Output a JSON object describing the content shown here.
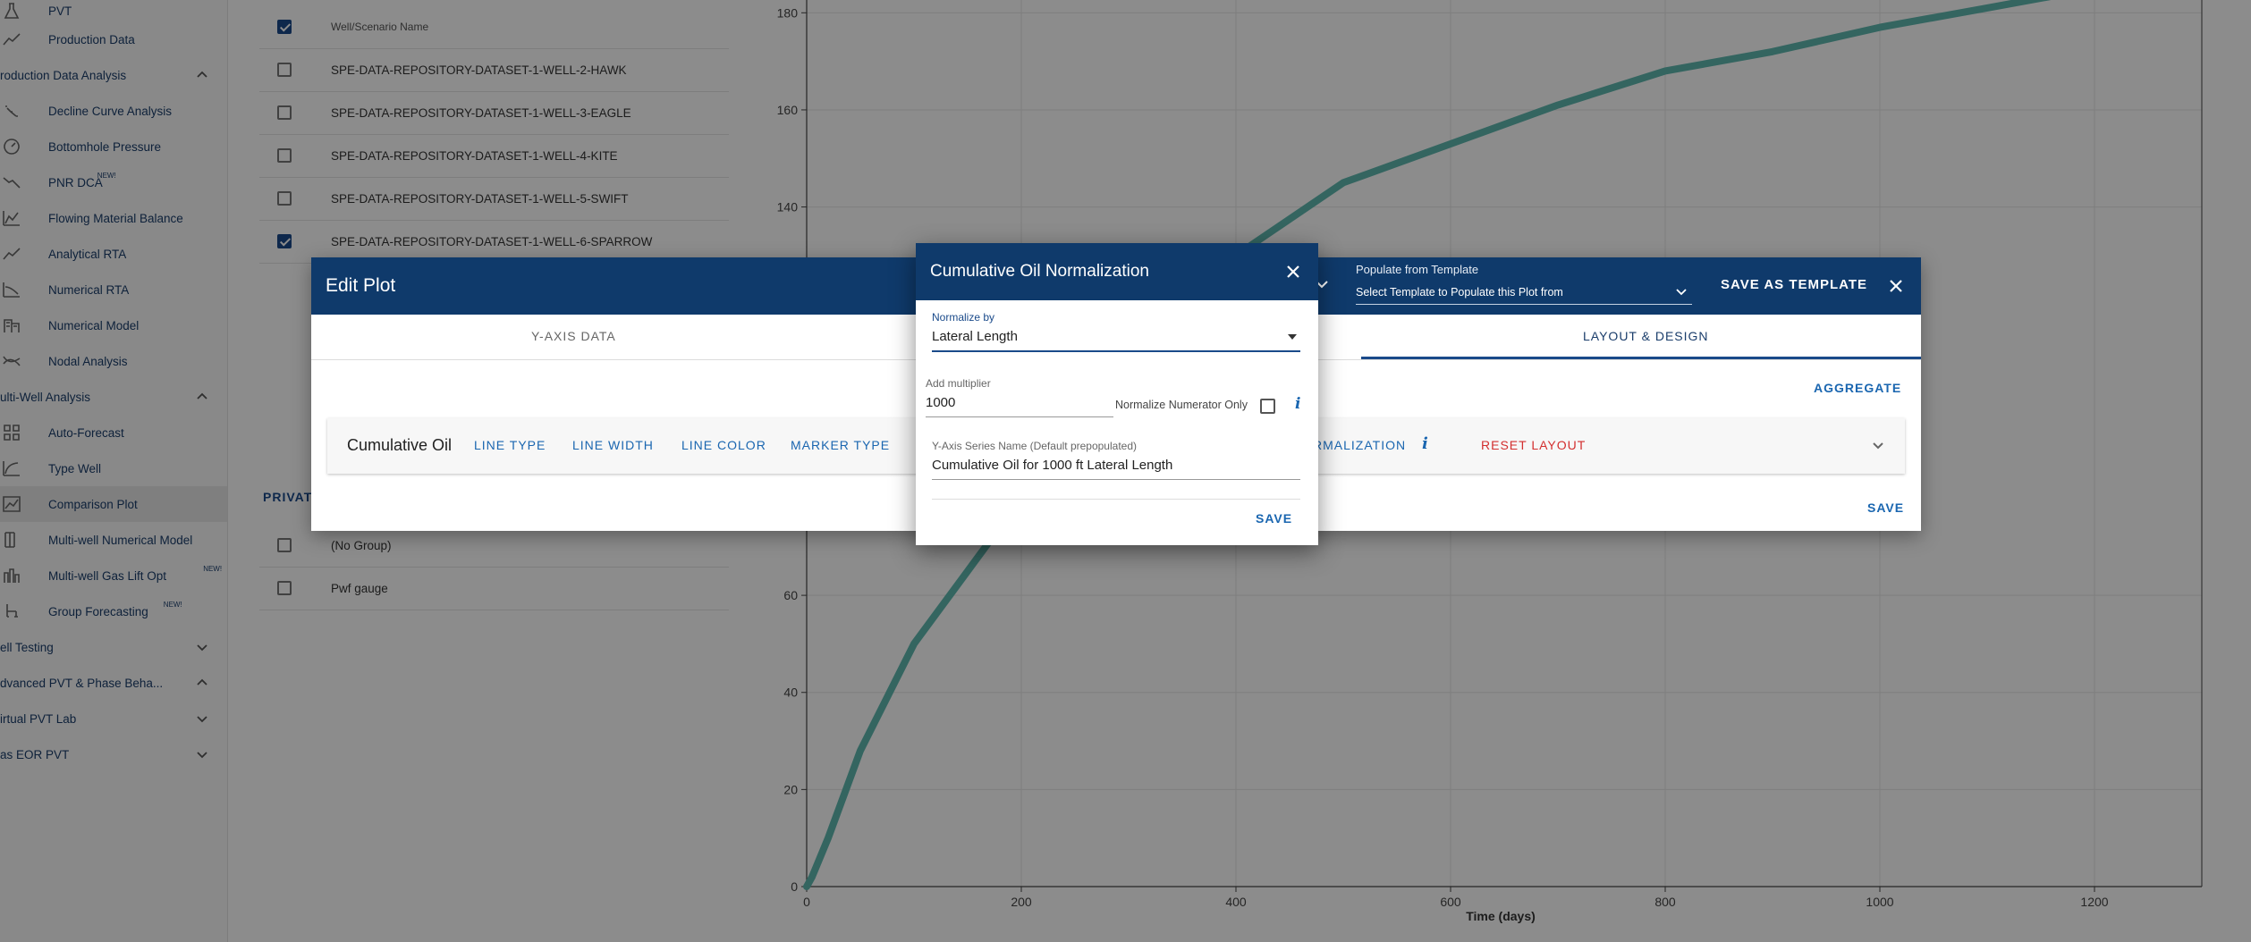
{
  "sidebar": {
    "items": [
      {
        "type": "sub",
        "label": "PVT",
        "icon": "flask-icon",
        "new": false
      },
      {
        "type": "sub",
        "label": "Production Data",
        "icon": "trend-line-icon",
        "new": false
      },
      {
        "type": "section",
        "label": "roduction Data Analysis",
        "expanded": true
      },
      {
        "type": "sub",
        "label": "Decline Curve Analysis",
        "icon": "scatter-icon",
        "new": false
      },
      {
        "type": "sub",
        "label": "Bottomhole Pressure",
        "icon": "gauge-icon",
        "new": false
      },
      {
        "type": "sub",
        "label": "PNR DCA",
        "icon": "decline-icon",
        "new": true
      },
      {
        "type": "sub",
        "label": "Flowing Material Balance",
        "icon": "area-chart-icon",
        "new": false
      },
      {
        "type": "sub",
        "label": "Analytical RTA",
        "icon": "trend-line-icon",
        "new": false
      },
      {
        "type": "sub",
        "label": "Numerical RTA",
        "icon": "curve-chart-icon",
        "new": false
      },
      {
        "type": "sub",
        "label": "Numerical Model",
        "icon": "building-icon",
        "new": false
      },
      {
        "type": "sub",
        "label": "Nodal Analysis",
        "icon": "nodal-icon",
        "new": false
      },
      {
        "type": "section",
        "label": "ulti-Well Analysis",
        "expanded": true
      },
      {
        "type": "sub",
        "label": "Auto-Forecast",
        "icon": "grid-icon",
        "new": false
      },
      {
        "type": "sub",
        "label": "Type Well",
        "icon": "type-curve-icon",
        "new": false
      },
      {
        "type": "sub",
        "label": "Comparison Plot",
        "icon": "comparison-icon",
        "new": false,
        "active": true
      },
      {
        "type": "sub",
        "label": "Multi-well Numerical Model",
        "icon": "columns-icon",
        "new": false
      },
      {
        "type": "sub",
        "label": "Multi-well Gas Lift Opt",
        "icon": "gas-lift-icon",
        "new": true
      },
      {
        "type": "sub",
        "label": "Group Forecasting",
        "icon": "tree-icon",
        "new": true
      },
      {
        "type": "section",
        "label": "ell Testing",
        "expanded": false
      },
      {
        "type": "section",
        "label": "dvanced PVT & Phase Beha...",
        "expanded": true
      },
      {
        "type": "section",
        "label": "irtual PVT Lab",
        "expanded": false
      },
      {
        "type": "section",
        "label": "as EOR PVT",
        "expanded": false
      }
    ],
    "new_badge": "NEW!"
  },
  "wells": {
    "header": "Well/Scenario Name",
    "header_checked": true,
    "rows": [
      {
        "name": "SPE-DATA-REPOSITORY-DATASET-1-WELL-2-HAWK",
        "checked": false
      },
      {
        "name": "SPE-DATA-REPOSITORY-DATASET-1-WELL-3-EAGLE",
        "checked": false
      },
      {
        "name": "SPE-DATA-REPOSITORY-DATASET-1-WELL-4-KITE",
        "checked": false
      },
      {
        "name": "SPE-DATA-REPOSITORY-DATASET-1-WELL-5-SWIFT",
        "checked": false
      },
      {
        "name": "SPE-DATA-REPOSITORY-DATASET-1-WELL-6-SPARROW",
        "checked": true
      }
    ],
    "group_tab": "PRIVAT",
    "groups": [
      {
        "name": "(No Group)",
        "checked": false
      },
      {
        "name": "Pwf gauge",
        "checked": false
      }
    ]
  },
  "chart_data": {
    "type": "line",
    "xlabel": "Time (days)",
    "ylabel": "",
    "xlim": [
      0,
      1300
    ],
    "ylim": [
      0,
      190
    ],
    "x_ticks": [
      0,
      200,
      400,
      600,
      800,
      1000,
      1200
    ],
    "y_ticks": [
      0,
      20,
      40,
      60,
      140,
      160,
      180
    ],
    "grid": true,
    "series": [
      {
        "color": "#5fb8b0",
        "x": [
          0,
          5,
          20,
          50,
          100,
          150,
          200,
          250,
          300,
          400,
          500,
          600,
          700,
          800,
          900,
          1000,
          1100,
          1200,
          1245
        ],
        "y": [
          0,
          2,
          10,
          28,
          50,
          65,
          80,
          95,
          108,
          130,
          145,
          153,
          161,
          168,
          172,
          177,
          181,
          185,
          187
        ]
      }
    ]
  },
  "edit_plot": {
    "title": "Edit Plot",
    "template_label": "Populate from Template",
    "template_placeholder": "Select Template to Populate this Plot from",
    "save_as_template": "SAVE AS TEMPLATE",
    "tabs": [
      "Y-AXIS DATA",
      "LAYOUT & DESIGN"
    ],
    "active_tab": "LAYOUT & DESIGN",
    "aggregate": "AGGREGATE",
    "series_name": "Cumulative Oil",
    "options": [
      "LINE TYPE",
      "LINE WIDTH",
      "LINE COLOR",
      "MARKER TYPE"
    ],
    "normalization_partial": "RMALIZATION",
    "reset_layout": "RESET LAYOUT",
    "save": "SAVE"
  },
  "normalization": {
    "title": "Cumulative Oil Normalization",
    "normalize_by_label": "Normalize by",
    "normalize_by_value": "Lateral Length",
    "multiplier_label": "Add multiplier",
    "multiplier_value": "1000",
    "numerator_only_label": "Normalize Numerator Only",
    "numerator_only_checked": false,
    "series_name_label": "Y-Axis Series Name (Default prepopulated)",
    "series_name_value": "Cumulative Oil for 1000 ft Lateral Length",
    "save": "SAVE"
  },
  "colors": {
    "header_blue": "#0f3a6b",
    "accent_blue": "#1a66b0",
    "reset_red": "#d32f2f",
    "series_teal": "#5fb8b0"
  }
}
